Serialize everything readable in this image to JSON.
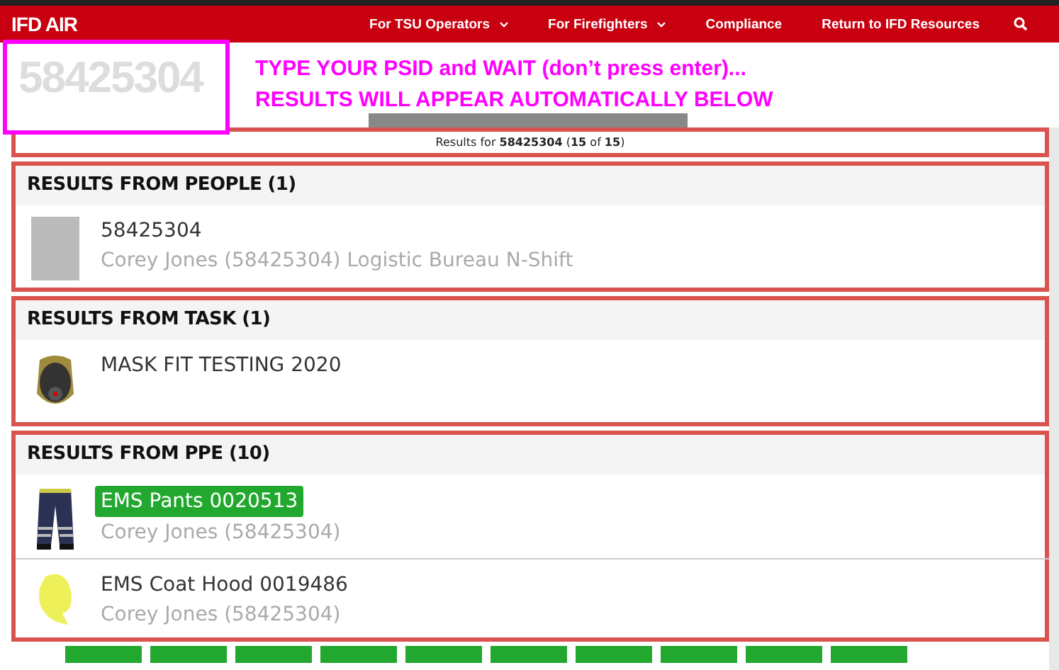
{
  "nav": {
    "logo": "IFD AIR",
    "items": [
      {
        "label": "For TSU Operators",
        "dropdown": true
      },
      {
        "label": "For Firefighters",
        "dropdown": true
      },
      {
        "label": "Compliance",
        "dropdown": false
      },
      {
        "label": "Return to IFD Resources",
        "dropdown": false
      }
    ]
  },
  "search": {
    "value": "58425304",
    "instructions": [
      "TYPE YOUR PSID and WAIT (don’t press enter)...",
      "RESULTS WILL APPEAR AUTOMATICALLY BELOW"
    ]
  },
  "results": {
    "summary": "Results for **58425304** (**15** of **15**)",
    "sections": [
      {
        "title": "RESULTS FROM PEOPLE (1)",
        "items": [
          {
            "kind": "person",
            "title": "58425304",
            "subtitle": "Corey Jones (58425304) Logistic Bureau N-Shift",
            "highlighted": false
          }
        ]
      },
      {
        "title": "RESULTS FROM TASK (1)",
        "items": [
          {
            "kind": "mask",
            "title": "MASK FIT TESTING 2020",
            "highlighted": false
          }
        ]
      },
      {
        "title": "RESULTS FROM PPE (10)",
        "items": [
          {
            "kind": "pants",
            "title": "EMS Pants 0020513",
            "subtitle": "Corey Jones (58425304)",
            "highlighted": true
          },
          {
            "kind": "hood",
            "title": "EMS Coat Hood 0019486",
            "subtitle": "Corey Jones (58425304)",
            "highlighted": false
          }
        ]
      }
    ]
  }
}
